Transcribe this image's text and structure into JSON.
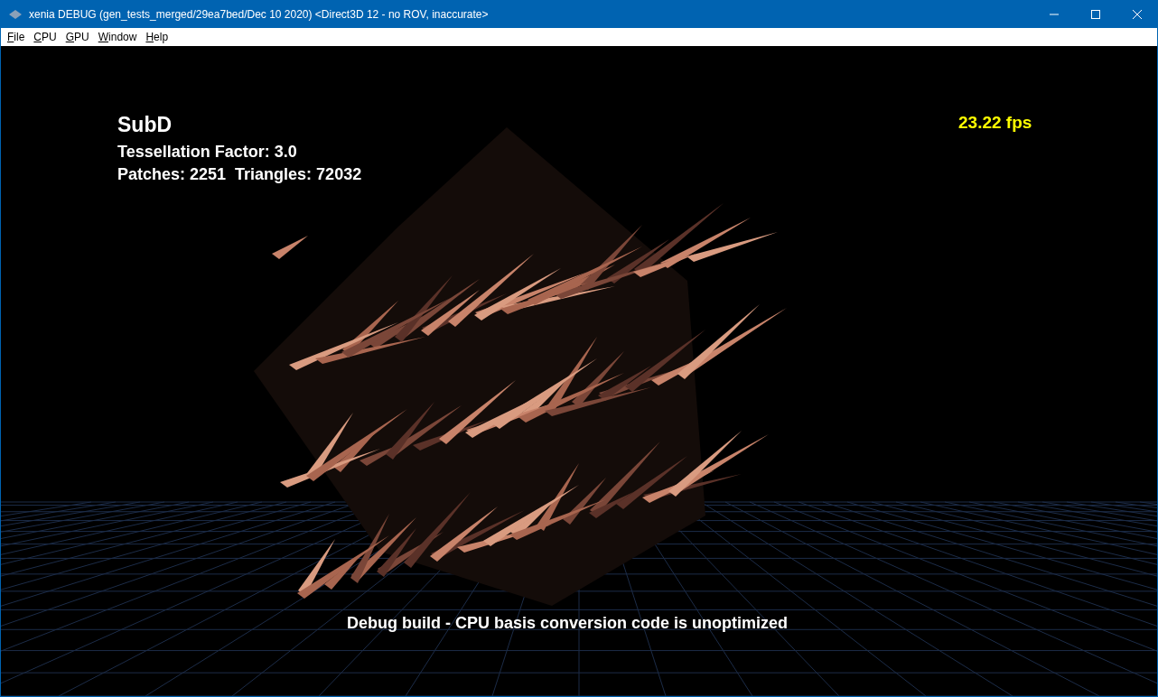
{
  "window": {
    "title": "xenia DEBUG (gen_tests_merged/29ea7bed/Dec 10 2020) <Direct3D 12 - no ROV, inaccurate>"
  },
  "menu": [
    "File",
    "CPU",
    "GPU",
    "Window",
    "Help"
  ],
  "viewport": {
    "heading": "SubD",
    "lines": [
      "Tessellation Factor: 3.0",
      "Patches: 2251  Triangles: 72032"
    ],
    "fps": "23.22 fps",
    "footer": "Debug build - CPU basis conversion code is unoptimized"
  }
}
